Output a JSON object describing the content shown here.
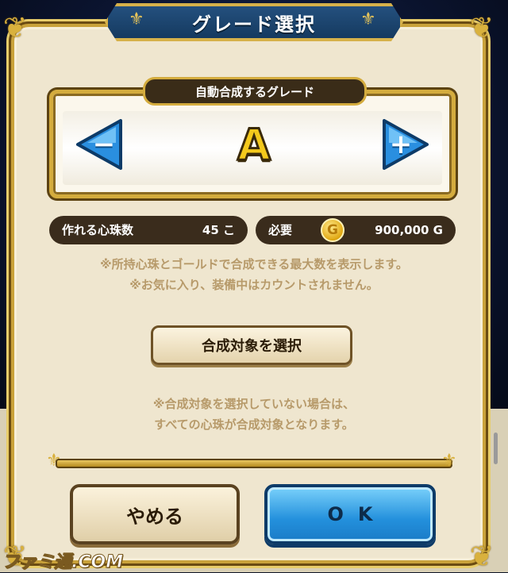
{
  "dialog": {
    "title": "グレード選択"
  },
  "grade": {
    "label": "自動合成するグレード",
    "value": "A",
    "decrease_symbol": "−",
    "increase_symbol": "+"
  },
  "stats": {
    "craftable_label": "作れる心珠数",
    "craftable_value": "45 こ",
    "required_label": "必要",
    "coin_symbol": "G",
    "required_value": "900,000 G"
  },
  "notes": {
    "line1": "※所持心珠とゴールドで合成できる最大数を表示します。",
    "line2": "※お気に入り、装備中はカウントされません。",
    "line3": "※合成対象を選択していない場合は、",
    "line4": "すべての心珠が合成対象となります。"
  },
  "buttons": {
    "select_target": "合成対象を選択",
    "cancel": "やめる",
    "ok": "OK"
  },
  "watermark": "ファミ通.COM",
  "colors": {
    "frame_gold": "#d4ac3e",
    "title_blue": "#1c4670",
    "panel_cream": "#efe6cf",
    "ok_blue": "#2390dc",
    "grade_yellow": "#f4c91c"
  }
}
